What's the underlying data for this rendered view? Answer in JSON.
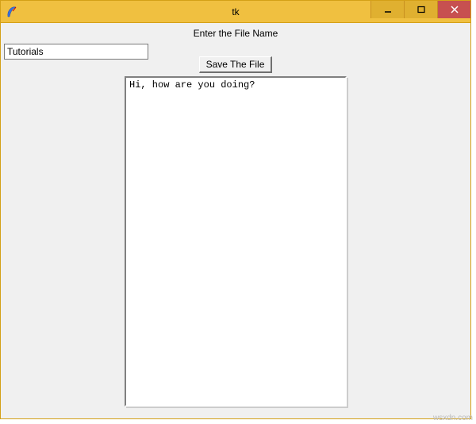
{
  "window": {
    "title": "tk"
  },
  "labels": {
    "prompt": "Enter the File Name",
    "save_button": "Save The File"
  },
  "inputs": {
    "filename_value": "Tutorials",
    "text_content": "Hi, how are you doing?"
  },
  "watermark": "wsxdn.com"
}
